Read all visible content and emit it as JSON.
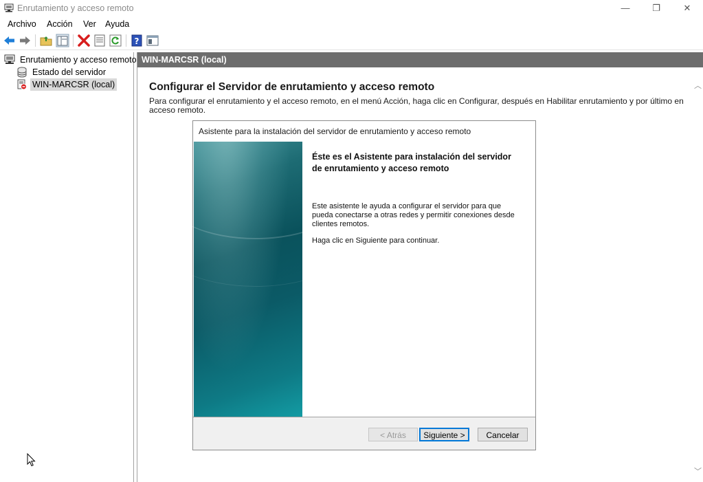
{
  "window": {
    "title": "Enrutamiento y acceso remoto",
    "controls": {
      "minimize": "—",
      "restore": "❐",
      "close": "✕"
    }
  },
  "menu": {
    "items": [
      "Archivo",
      "Acción",
      "Ver",
      "Ayuda"
    ]
  },
  "toolbar": {
    "buttons": [
      "back-icon",
      "forward-icon",
      "up-folder-icon",
      "show-hide-tree-icon",
      "delete-icon",
      "properties-icon",
      "refresh-icon",
      "help-icon",
      "console-icon"
    ]
  },
  "tree": {
    "root": "Enrutamiento y acceso remoto",
    "items": [
      {
        "label": "Estado del servidor",
        "icon": "server-status-icon"
      },
      {
        "label": "WIN-MARCSR (local)",
        "icon": "server-down-icon",
        "selected": true
      }
    ]
  },
  "right": {
    "header": "WIN-MARCSR (local)",
    "title": "Configurar el Servidor de enrutamiento y acceso remoto",
    "description": "Para configurar el enrutamiento y el acceso remoto, en el menú Acción, haga clic en Configurar, después en Habilitar enrutamiento y por último en acceso remoto."
  },
  "wizard": {
    "title": "Asistente para la instalación del servidor de enrutamiento y acceso remoto",
    "heading": "Éste es el Asistente para instalación del servidor de enrutamiento y acceso remoto",
    "body1": "Este asistente le ayuda a configurar el servidor para que pueda conectarse a otras redes y permitir conexiones desde clientes remotos.",
    "body2": "Haga clic en Siguiente para continuar.",
    "buttons": {
      "back": "< Atrás",
      "next": "Siguiente >",
      "cancel": "Cancelar"
    }
  }
}
